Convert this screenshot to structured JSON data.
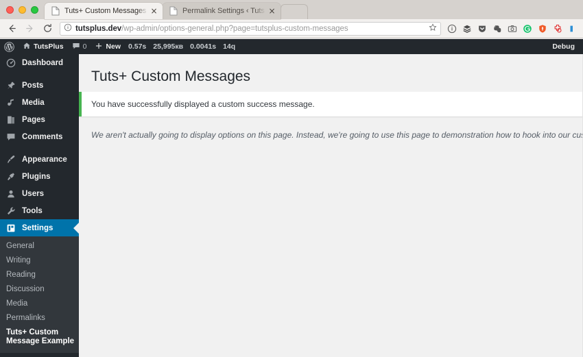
{
  "browser": {
    "tabs": [
      {
        "title": "Tuts+ Custom Messages ‹ Tuts",
        "active": true,
        "favicon": "page-icon",
        "close": "×"
      },
      {
        "title": "Permalink Settings ‹ TutsPlus -",
        "active": false,
        "favicon": "page-icon",
        "close": "×"
      }
    ],
    "new_tab_label": "",
    "nav": {
      "back": "back-arrow",
      "forward": "forward-arrow",
      "reload": "reload-arrow"
    },
    "omnibox": {
      "security_icon": "info-circle-icon",
      "url_domain": "tutsplus.dev",
      "url_path": "/wp-admin/options-general.php?page=tutsplus-custom-messages",
      "bookmark_icon": "star-icon"
    },
    "extensions": [
      "info-circle-icon",
      "layers-stack-icon",
      "pocket-shield-icon",
      "evernote-elephant-icon",
      "camera-screenshot-icon",
      "grammarly-g-icon",
      "orange-shield-icon",
      "clock-plus-icon",
      "blue-bar-icon"
    ],
    "window_controls": [
      "close-light",
      "minimize-light",
      "zoom-light"
    ]
  },
  "adminbar": {
    "logo": "wordpress-logo-icon",
    "site_icon": "home-icon",
    "site_name": "TutsPlus",
    "comments_icon": "comment-bubble-icon",
    "comments_count": "0",
    "new_icon": "plus-icon",
    "new_label": "New",
    "stats": [
      "0.57s",
      "25,995кв",
      "0.0041s",
      "14q"
    ],
    "debug_label": "Debug"
  },
  "adminmenu": {
    "items": [
      {
        "label": "Dashboard",
        "icon": "dashboard-gauge-icon",
        "current": false,
        "sep_after": true
      },
      {
        "label": "Posts",
        "icon": "pin-icon",
        "current": false,
        "sep_after": false
      },
      {
        "label": "Media",
        "icon": "media-icon",
        "current": false,
        "sep_after": false
      },
      {
        "label": "Pages",
        "icon": "pages-icon",
        "current": false,
        "sep_after": false
      },
      {
        "label": "Comments",
        "icon": "comment-bubble-icon",
        "current": false,
        "sep_after": true
      },
      {
        "label": "Appearance",
        "icon": "paintbrush-icon",
        "current": false,
        "sep_after": false
      },
      {
        "label": "Plugins",
        "icon": "plug-icon",
        "current": false,
        "sep_after": false
      },
      {
        "label": "Users",
        "icon": "user-icon",
        "current": false,
        "sep_after": false
      },
      {
        "label": "Tools",
        "icon": "wrench-icon",
        "current": false,
        "sep_after": false
      },
      {
        "label": "Settings",
        "icon": "settings-sliders-icon",
        "current": true,
        "sep_after": false
      }
    ],
    "submenu": [
      {
        "label": "General",
        "current": false
      },
      {
        "label": "Writing",
        "current": false
      },
      {
        "label": "Reading",
        "current": false
      },
      {
        "label": "Discussion",
        "current": false
      },
      {
        "label": "Media",
        "current": false
      },
      {
        "label": "Permalinks",
        "current": false
      },
      {
        "label": "Tuts+ Custom Message Example",
        "current": true
      }
    ]
  },
  "main": {
    "page_title": "Tuts+ Custom Messages",
    "notice_text": "You have successfully displayed a custom success message.",
    "description": "We aren't actually going to display options on this page. Instead, we're going to use this page to demonstration how to hook into our custom messenger."
  },
  "colors": {
    "wp_blue": "#0073aa",
    "admin_dark": "#23282d",
    "submenu_dark": "#32373c",
    "notice_green": "#46b450",
    "content_bg": "#f1f1f1"
  }
}
